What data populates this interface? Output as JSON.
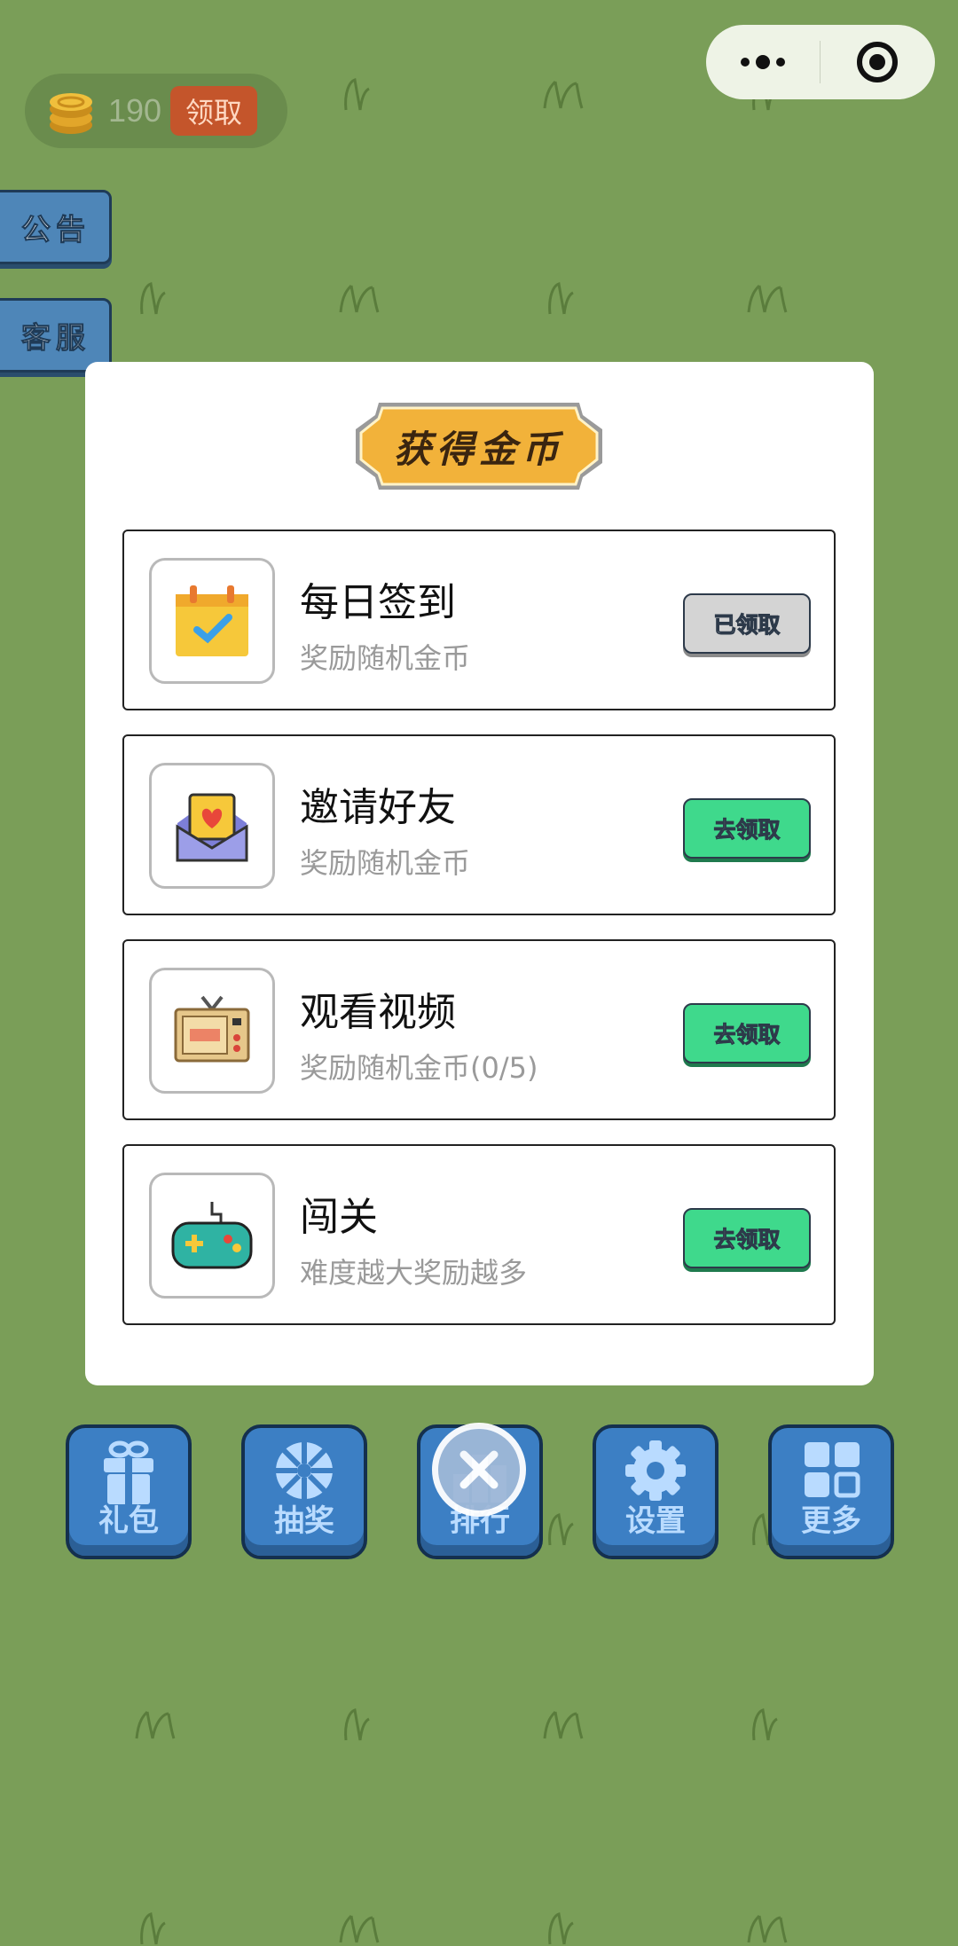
{
  "top_capsule": {
    "more_icon": "more-dots-icon",
    "close_icon": "target-close-icon"
  },
  "coins": {
    "count": "190",
    "claim_label": "领取"
  },
  "side_tabs": [
    {
      "label": "公告"
    },
    {
      "label": "客服"
    }
  ],
  "modal": {
    "title": "获得金币",
    "tasks": [
      {
        "title": "每日签到",
        "desc": "奖励随机金币",
        "button": "已领取",
        "state": "done",
        "icon": "calendar-check-icon"
      },
      {
        "title": "邀请好友",
        "desc": "奖励随机金币",
        "button": "去领取",
        "state": "go",
        "icon": "invite-envelope-icon"
      },
      {
        "title": "观看视频",
        "desc": "奖励随机金币(0/5)",
        "button": "去领取",
        "state": "go",
        "icon": "tv-video-icon"
      },
      {
        "title": "闯关",
        "desc": "难度越大奖励越多",
        "button": "去领取",
        "state": "go",
        "icon": "gamepad-icon"
      }
    ]
  },
  "bottom_nav": [
    {
      "label": "礼包",
      "icon": "gift-icon"
    },
    {
      "label": "抽奖",
      "icon": "wheel-icon"
    },
    {
      "label": "排行",
      "icon": "ranking-icon"
    },
    {
      "label": "设置",
      "icon": "gear-icon"
    },
    {
      "label": "更多",
      "icon": "grid-icon"
    }
  ],
  "colors": {
    "background": "#7a9e58",
    "go_button": "#3fd98c",
    "nav_button": "#3c7fc4",
    "banner": "#f2b23a"
  }
}
